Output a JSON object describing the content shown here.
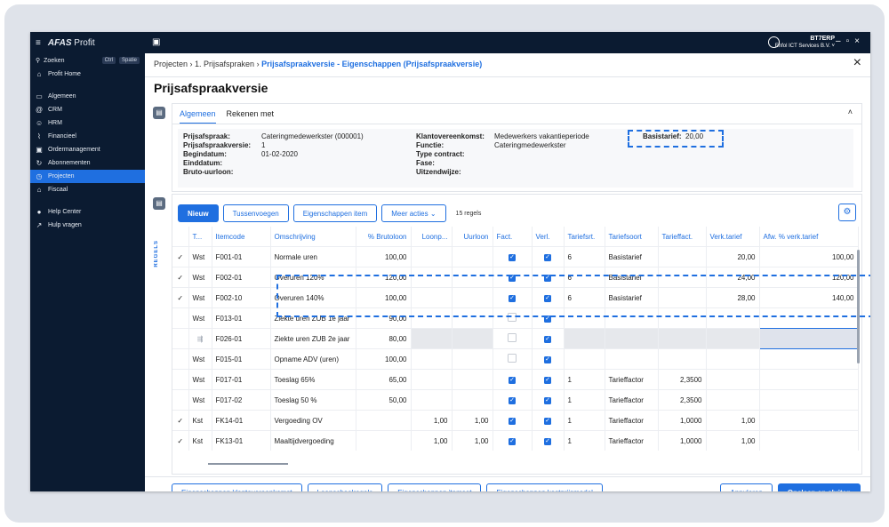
{
  "app": {
    "name": "AFAS",
    "name_suffix": "Profit",
    "user": "BT7ERP",
    "company": "Enfol ICT Services B.V."
  },
  "sidebar": {
    "search": {
      "label": "Zoeken",
      "kbd1": "Ctrl",
      "kbd2": "Spatie"
    },
    "home": "Profit Home",
    "items": [
      {
        "label": "Algemeen",
        "icon": "monitor-icon"
      },
      {
        "label": "CRM",
        "icon": "at-icon"
      },
      {
        "label": "HRM",
        "icon": "users-icon"
      },
      {
        "label": "Financieel",
        "icon": "chart-icon"
      },
      {
        "label": "Ordermanagement",
        "icon": "box-icon"
      },
      {
        "label": "Abonnementen",
        "icon": "cycle-icon"
      },
      {
        "label": "Projecten",
        "icon": "clock-icon",
        "active": true
      },
      {
        "label": "Fiscaal",
        "icon": "bank-icon"
      }
    ],
    "help": "Help Center",
    "ask": "Hulp vragen"
  },
  "breadcrumb": {
    "p1": "Projecten",
    "p2": "1. Prijsafspraken",
    "current": "Prijsafspraakversie - Eigenschappen (Prijsafspraakversie)"
  },
  "page_title": "Prijsafspraakversie",
  "tabs": [
    "Algemeen",
    "Rekenen met"
  ],
  "fields": {
    "col1": [
      {
        "label": "Prijsafspraak:",
        "value": "Cateringmedewerkster (000001)"
      },
      {
        "label": "Prijsafspraakversie:",
        "value": "1"
      },
      {
        "label": "Begindatum:",
        "value": "01-02-2020"
      },
      {
        "label": "Einddatum:",
        "value": ""
      },
      {
        "label": "Bruto-uurloon:",
        "value": ""
      }
    ],
    "col2": [
      {
        "label": "Klantovereenkomst:",
        "value": "Medewerkers vakantieperiode"
      },
      {
        "label": "Functie:",
        "value": "Cateringmedewerkster"
      },
      {
        "label": "Type contract:",
        "value": ""
      },
      {
        "label": "Fase:",
        "value": ""
      },
      {
        "label": "Uitzendwijze:",
        "value": ""
      }
    ],
    "basis": {
      "label": "Basistarief:",
      "value": "20,00"
    }
  },
  "side_label": "REGELS",
  "toolbar": {
    "new": "Nieuw",
    "insert": "Tussenvoegen",
    "item_props": "Eigenschappen item",
    "more": "Meer acties",
    "count": "15 regels"
  },
  "table": {
    "headers": [
      "T...",
      "Itemcode",
      "Omschrijving",
      "% Brutoloon",
      "Loonp...",
      "Uurloon",
      "Fact.",
      "Verl.",
      "Tariefsrt.",
      "Tariefsoort",
      "Tarieffact.",
      "Verk.tarief",
      "Afw. % verk.tarief"
    ],
    "rows": [
      {
        "mark": "✓",
        "t": "Wst",
        "code": "F001-01",
        "desc": "Normale uren",
        "pct": "100,00",
        "loonp": "",
        "uur": "",
        "fact": true,
        "verl": true,
        "srt": "6",
        "soort": "Basistarief",
        "tf": "",
        "vt": "20,00",
        "afw": "100,00"
      },
      {
        "mark": "✓",
        "t": "Wst",
        "code": "F002-01",
        "desc": "Overuren 120%",
        "pct": "120,00",
        "loonp": "",
        "uur": "",
        "fact": true,
        "verl": true,
        "srt": "6",
        "soort": "Basistarief",
        "tf": "",
        "vt": "24,00",
        "afw": "120,00"
      },
      {
        "mark": "✓",
        "t": "Wst",
        "code": "F002-10",
        "desc": "Overuren 140%",
        "pct": "100,00",
        "loonp": "",
        "uur": "",
        "fact": true,
        "verl": true,
        "srt": "6",
        "soort": "Basistarief",
        "tf": "",
        "vt": "28,00",
        "afw": "140,00"
      },
      {
        "mark": "",
        "t": "Wst",
        "code": "F013-01",
        "desc": "Ziekte uren ZUB 1e jaar",
        "pct": "90,00",
        "loonp": "",
        "uur": "",
        "fact": false,
        "verl": true,
        "srt": "",
        "soort": "",
        "tf": "",
        "vt": "",
        "afw": ""
      },
      {
        "mark": "",
        "t": "",
        "code": "F026-01",
        "desc": "Ziekte uren ZUB 2e jaar",
        "pct": "80,00",
        "loonp": "",
        "uur": "",
        "fact": false,
        "verl": true,
        "srt": "",
        "soort": "",
        "tf": "",
        "vt": "",
        "afw": "",
        "grey": true
      },
      {
        "mark": "",
        "t": "Wst",
        "code": "F015-01",
        "desc": "Opname ADV (uren)",
        "pct": "100,00",
        "loonp": "",
        "uur": "",
        "fact": false,
        "verl": true,
        "srt": "",
        "soort": "",
        "tf": "",
        "vt": "",
        "afw": ""
      },
      {
        "mark": "",
        "t": "Wst",
        "code": "F017-01",
        "desc": "Toeslag 65%",
        "pct": "65,00",
        "loonp": "",
        "uur": "",
        "fact": true,
        "verl": true,
        "srt": "1",
        "soort": "Tarieffactor",
        "tf": "2,3500",
        "vt": "",
        "afw": ""
      },
      {
        "mark": "",
        "t": "Wst",
        "code": "F017-02",
        "desc": "Toeslag 50 %",
        "pct": "50,00",
        "loonp": "",
        "uur": "",
        "fact": true,
        "verl": true,
        "srt": "1",
        "soort": "Tarieffactor",
        "tf": "2,3500",
        "vt": "",
        "afw": ""
      },
      {
        "mark": "✓",
        "t": "Kst",
        "code": "FK14-01",
        "desc": "Vergoeding OV",
        "pct": "",
        "loonp": "1,00",
        "uur": "1,00",
        "fact": true,
        "verl": true,
        "srt": "1",
        "soort": "Tarieffactor",
        "tf": "1,0000",
        "vt": "1,00",
        "afw": ""
      },
      {
        "mark": "✓",
        "t": "Kst",
        "code": "FK13-01",
        "desc": "Maaltijdvergoeding",
        "pct": "",
        "loonp": "1,00",
        "uur": "1,00",
        "fact": true,
        "verl": true,
        "srt": "1",
        "soort": "Tarieffactor",
        "tf": "1,0000",
        "vt": "1,00",
        "afw": ""
      }
    ]
  },
  "footer": {
    "b1": "Eigenschappen klantovereenkomst",
    "b2": "Loonschaalregels",
    "b3": "Eigenschappen itemset",
    "b4": "Eigenschappen kostprijsmodel",
    "cancel": "Annuleren",
    "save": "Opslaan en sluiten"
  },
  "colors": {
    "accent": "#1f6fe0",
    "sidebar": "#0b1b31"
  }
}
